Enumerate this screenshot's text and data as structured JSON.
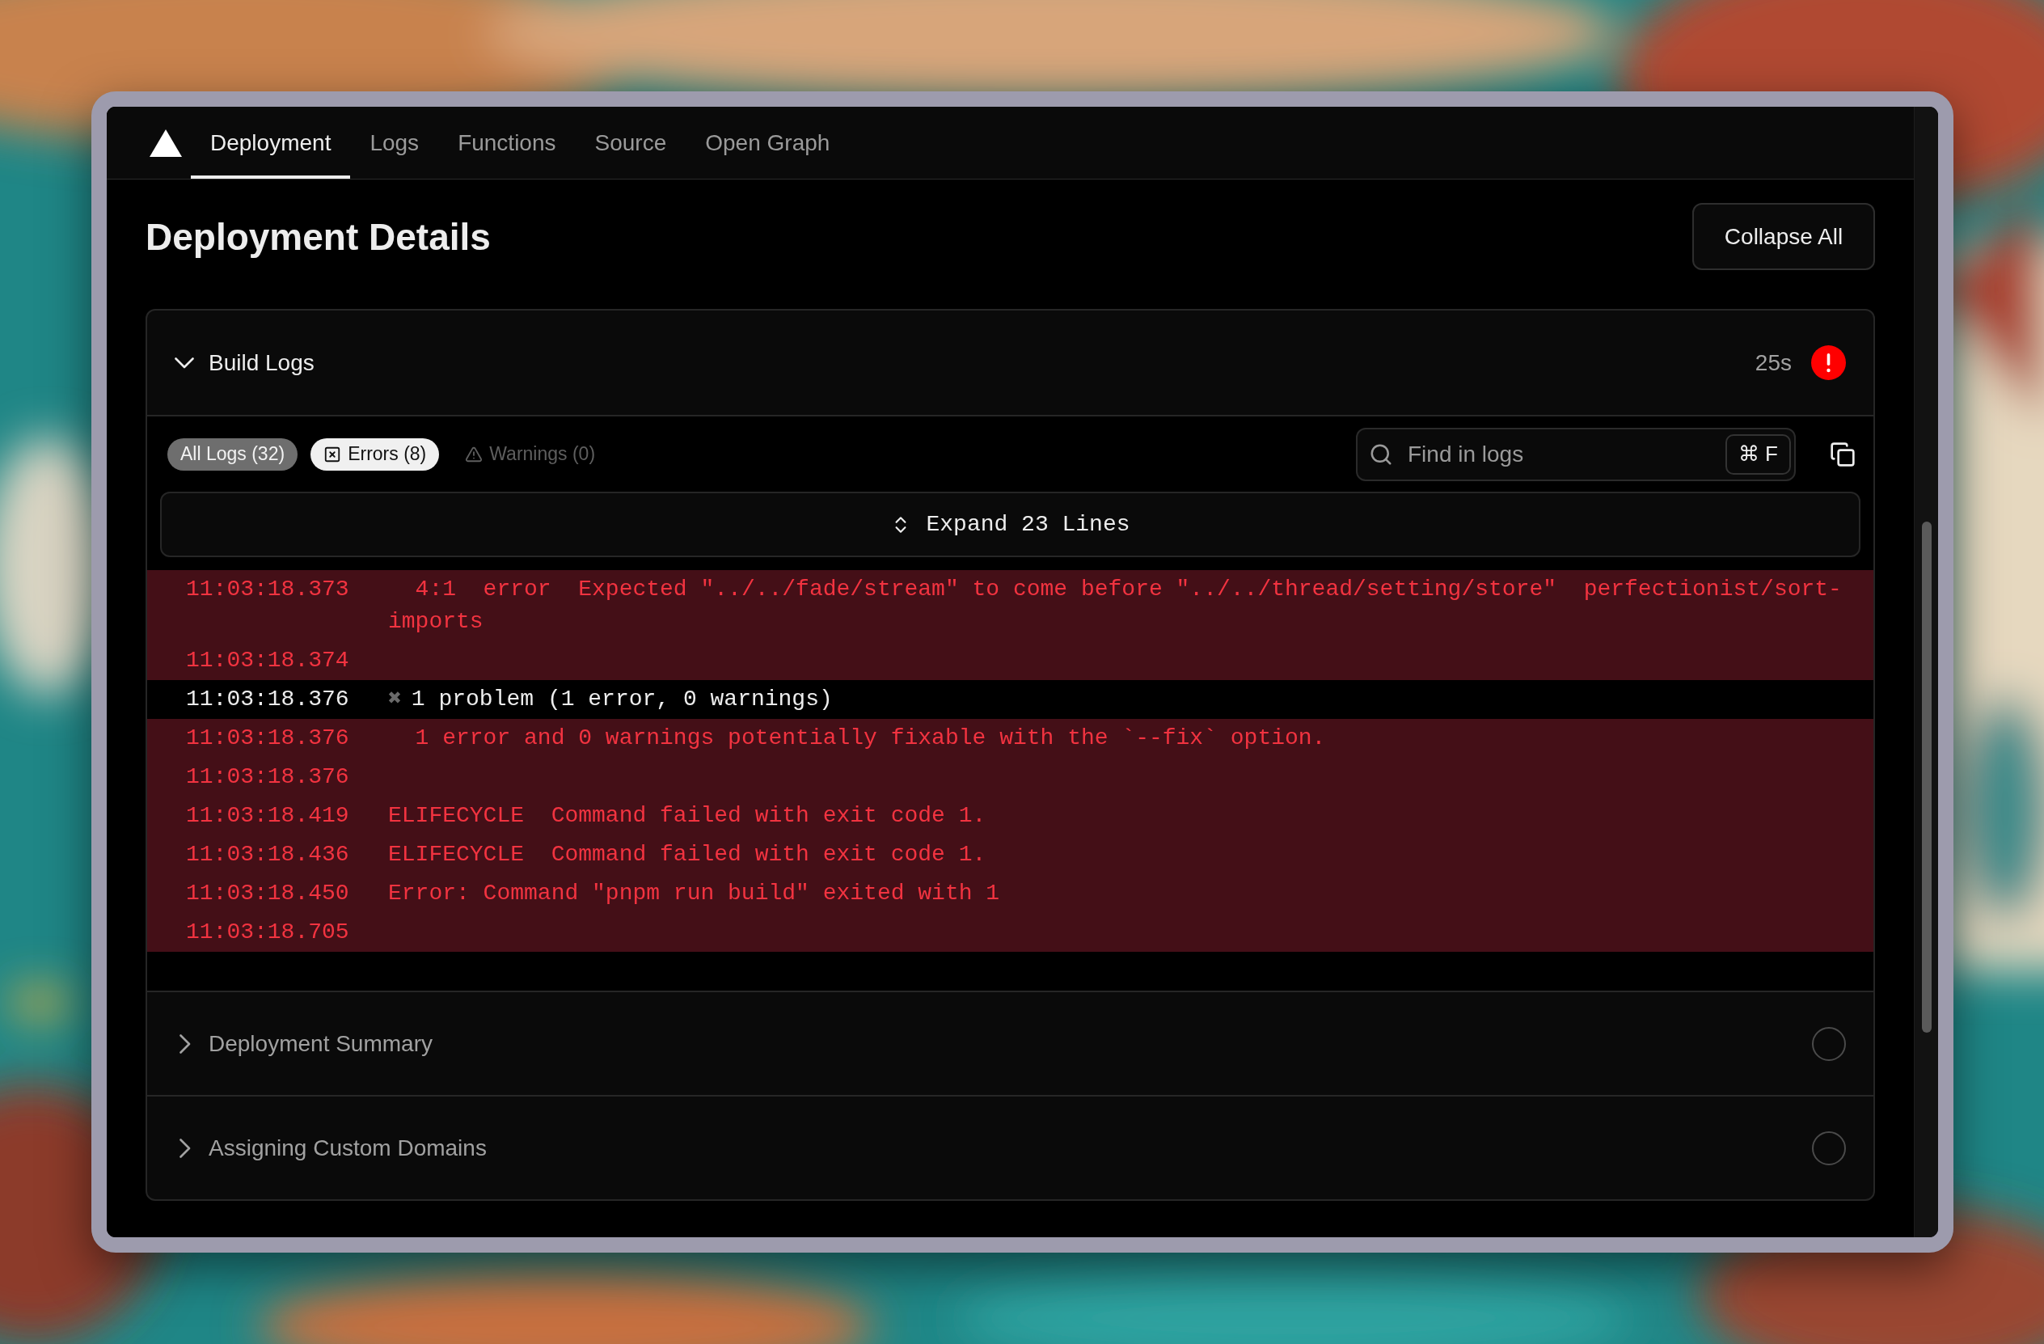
{
  "nav": {
    "tabs": [
      {
        "label": "Deployment",
        "selected": true
      },
      {
        "label": "Logs",
        "selected": false
      },
      {
        "label": "Functions",
        "selected": false
      },
      {
        "label": "Source",
        "selected": false
      },
      {
        "label": "Open Graph",
        "selected": false
      }
    ]
  },
  "page_title": "Deployment Details",
  "collapse_button": "Collapse All",
  "sections": [
    {
      "title": "Build Logs",
      "expanded": true,
      "duration": "25s",
      "failed": true,
      "logs": {
        "filters": [
          {
            "kind": "all",
            "label": "All Logs (32)",
            "selected": false,
            "disabled": false
          },
          {
            "kind": "error",
            "label": "Errors (8)",
            "selected": true,
            "disabled": false
          },
          {
            "kind": "warning",
            "label": "Warnings (0)",
            "selected": false,
            "disabled": true
          }
        ],
        "search": {
          "placeholder": "Find in logs",
          "shortcut": "⌘ F"
        },
        "expand_button": "Expand 23 Lines",
        "rows": [
          {
            "kind": "error",
            "time": "11:03:18.373",
            "message": "  4:1  error  Expected \"../../fade/stream\" to come before \"../../thread/setting/store\"  perfectionist/sort-imports"
          },
          {
            "kind": "error",
            "time": "11:03:18.374"
          },
          {
            "kind": "info",
            "time": "11:03:18.376",
            "mark": "✖",
            "message": "1 problem (1 error, 0 warnings)"
          },
          {
            "kind": "error",
            "time": "11:03:18.376",
            "message": "  1 error and 0 warnings potentially fixable with the `--fix` option."
          },
          {
            "kind": "error",
            "time": "11:03:18.376"
          },
          {
            "kind": "error",
            "time": "11:03:18.419",
            "message": "ELIFECYCLE  Command failed with exit code 1."
          },
          {
            "kind": "error",
            "time": "11:03:18.436",
            "message": "ELIFECYCLE  Command failed with exit code 1."
          },
          {
            "kind": "error",
            "time": "11:03:18.450",
            "message": "Error: Command \"pnpm run build\" exited with 1"
          },
          {
            "kind": "error",
            "time": "11:03:18.705"
          }
        ]
      }
    },
    {
      "title": "Deployment Summary",
      "expanded": false,
      "failed": false
    },
    {
      "title": "Assigning Custom Domains",
      "expanded": false,
      "failed": false
    }
  ]
}
